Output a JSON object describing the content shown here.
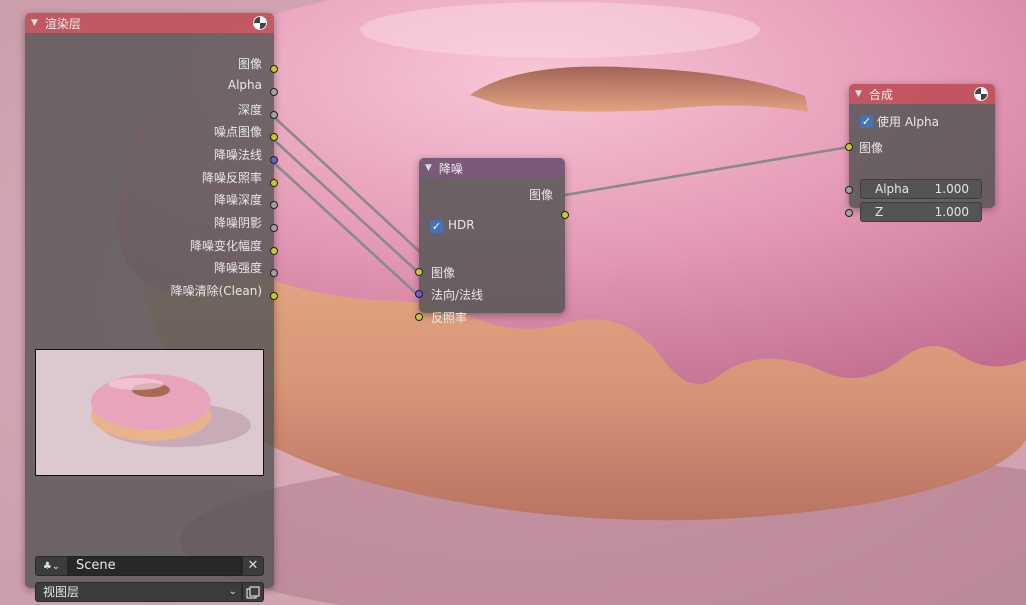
{
  "render_layers_node": {
    "title": "渲染层",
    "outputs": [
      {
        "label": "图像",
        "socket_color": "#c7c729"
      },
      {
        "label": "Alpha",
        "socket_color": "#a1a1a1"
      },
      {
        "label": "深度",
        "socket_color": "#a1a1a1"
      },
      {
        "label": "噪点图像",
        "socket_color": "#c7c729"
      },
      {
        "label": "降噪法线",
        "socket_color": "#6363c7"
      },
      {
        "label": "降噪反照率",
        "socket_color": "#c7c729"
      },
      {
        "label": "降噪深度",
        "socket_color": "#a1a1a1"
      },
      {
        "label": "降噪阴影",
        "socket_color": "#a1a1a1"
      },
      {
        "label": "降噪变化幅度",
        "socket_color": "#c7c729"
      },
      {
        "label": "降噪强度",
        "socket_color": "#a1a1a1"
      },
      {
        "label": "降噪清除(Clean)",
        "socket_color": "#c7c729"
      }
    ],
    "scene_field": "Scene",
    "view_layer_select": "视图层"
  },
  "denoise_node": {
    "title": "降噪",
    "output_image": "图像",
    "hdr_label": "HDR",
    "hdr_checked": true,
    "inputs": [
      {
        "label": "图像",
        "socket_color": "#c7c729"
      },
      {
        "label": "法向/法线",
        "socket_color": "#6363c7"
      },
      {
        "label": "反照率",
        "socket_color": "#c7c729"
      }
    ]
  },
  "composite_node": {
    "title": "合成",
    "use_alpha_label": "使用 Alpha",
    "use_alpha_checked": true,
    "image_input": "图像",
    "alpha": {
      "label": "Alpha",
      "value": "1.000"
    },
    "z": {
      "label": "Z",
      "value": "1.000"
    }
  },
  "colors": {
    "render_header": "#be4e58",
    "denoise_header": "#6e5070",
    "node_body": "#555555",
    "socket_yellow": "#c7c729",
    "socket_gray": "#a1a1a1",
    "socket_blue": "#6363c7",
    "checkbox": "#4772b3"
  }
}
